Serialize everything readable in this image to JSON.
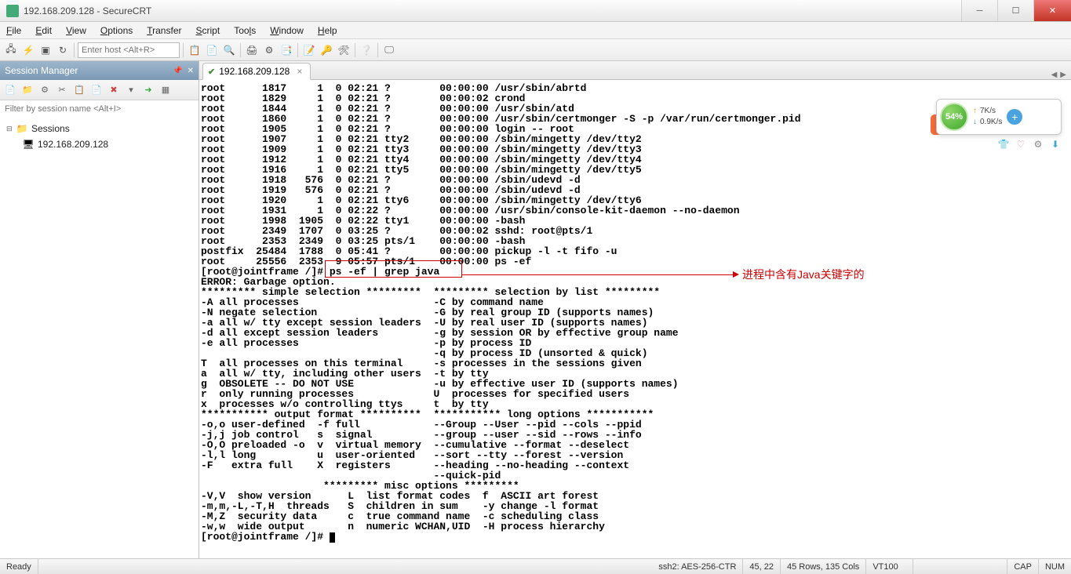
{
  "title": "192.168.209.128 - SecureCRT",
  "menu": {
    "file": "File",
    "edit": "Edit",
    "view": "View",
    "options": "Options",
    "transfer": "Transfer",
    "script": "Script",
    "tools": "Tools",
    "window": "Window",
    "help": "Help"
  },
  "toolbar": {
    "host_placeholder": "Enter host <Alt+R>"
  },
  "sidebar": {
    "title": "Session Manager",
    "filter_placeholder": "Filter by session name <Alt+I>",
    "root": "Sessions",
    "session": "192.168.209.128"
  },
  "tab": {
    "label": "192.168.209.128"
  },
  "terminal_lines": [
    "root      1817     1  0 02:21 ?        00:00:00 /usr/sbin/abrtd",
    "root      1829     1  0 02:21 ?        00:00:02 crond",
    "root      1844     1  0 02:21 ?        00:00:00 /usr/sbin/atd",
    "root      1860     1  0 02:21 ?        00:00:00 /usr/sbin/certmonger -S -p /var/run/certmonger.pid",
    "root      1905     1  0 02:21 ?        00:00:00 login -- root",
    "root      1907     1  0 02:21 tty2     00:00:00 /sbin/mingetty /dev/tty2",
    "root      1909     1  0 02:21 tty3     00:00:00 /sbin/mingetty /dev/tty3",
    "root      1912     1  0 02:21 tty4     00:00:00 /sbin/mingetty /dev/tty4",
    "root      1916     1  0 02:21 tty5     00:00:00 /sbin/mingetty /dev/tty5",
    "root      1918   576  0 02:21 ?        00:00:00 /sbin/udevd -d",
    "root      1919   576  0 02:21 ?        00:00:00 /sbin/udevd -d",
    "root      1920     1  0 02:21 tty6     00:00:00 /sbin/mingetty /dev/tty6",
    "root      1931     1  0 02:22 ?        00:00:00 /usr/sbin/console-kit-daemon --no-daemon",
    "root      1998  1905  0 02:22 tty1     00:00:00 -bash",
    "root      2349  1707  0 03:25 ?        00:00:02 sshd: root@pts/1",
    "root      2353  2349  0 03:25 pts/1    00:00:00 -bash",
    "postfix  25484  1788  0 05:41 ?        00:00:00 pickup -l -t fifo -u",
    "root     25556  2353  9 05:57 pts/1    00:00:00 ps -ef",
    "[root@jointframe /]# ps -ef | grep java",
    "ERROR: Garbage option.",
    "********* simple selection *********  ********* selection by list *********",
    "-A all processes                      -C by command name",
    "-N negate selection                   -G by real group ID (supports names)",
    "-a all w/ tty except session leaders  -U by real user ID (supports names)",
    "-d all except session leaders         -g by session OR by effective group name",
    "-e all processes                      -p by process ID",
    "                                      -q by process ID (unsorted & quick)",
    "T  all processes on this terminal     -s processes in the sessions given",
    "a  all w/ tty, including other users  -t by tty",
    "g  OBSOLETE -- DO NOT USE             -u by effective user ID (supports names)",
    "r  only running processes             U  processes for specified users",
    "x  processes w/o controlling ttys     t  by tty",
    "*********** output format **********  *********** long options ***********",
    "-o,o user-defined  -f full            --Group --User --pid --cols --ppid",
    "-j,j job control   s  signal          --group --user --sid --rows --info",
    "-O,O preloaded -o  v  virtual memory  --cumulative --format --deselect",
    "-l,l long          u  user-oriented   --sort --tty --forest --version",
    "-F   extra full    X  registers       --heading --no-heading --context",
    "                                      --quick-pid",
    "                    ********* misc options *********",
    "-V,V  show version      L  list format codes  f  ASCII art forest",
    "-m,m,-L,-T,H  threads   S  children in sum    -y change -l format",
    "-M,Z  security data     c  true command name  -c scheduling class",
    "-w,w  wide output       n  numeric WCHAN,UID  -H process hierarchy",
    "[root@jointframe /]# "
  ],
  "annotation": "进程中含有Java关键字的",
  "status": {
    "ready": "Ready",
    "proto": "ssh2: AES-256-CTR",
    "pos": "45,  22",
    "size": "45 Rows, 135 Cols",
    "term": "VT100",
    "cap": "CAP",
    "num": "NUM"
  },
  "widget": {
    "pct": "54%",
    "up": "7K/s",
    "down": "0.9K/s"
  },
  "sogou": "S"
}
